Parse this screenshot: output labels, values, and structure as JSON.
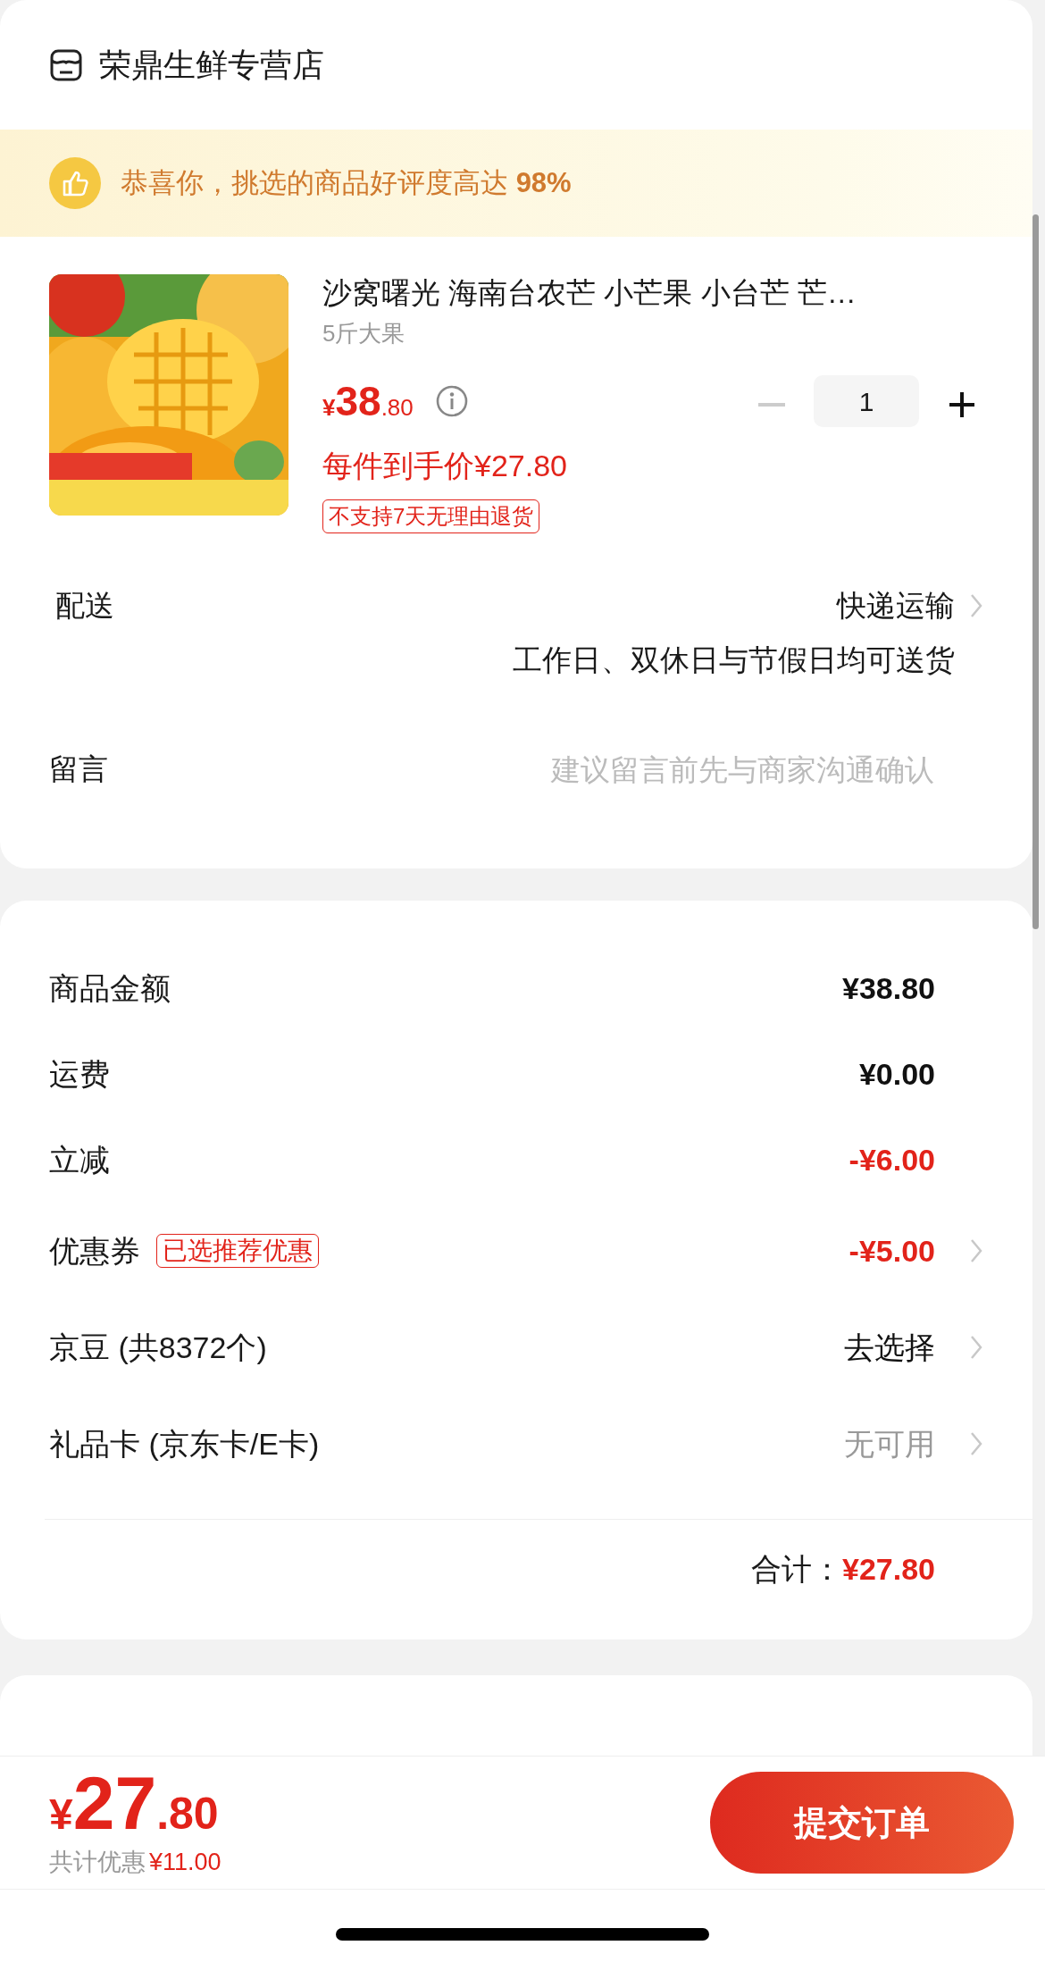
{
  "store": {
    "name": "荣鼎生鲜专营店"
  },
  "banner": {
    "text": "恭喜你，挑选的商品好评度高达 **98%**"
  },
  "product": {
    "title": "沙窝曙光 海南台农芒 小芒果 小台芒 芒…",
    "spec": "5斤大果",
    "price_symbol": "¥",
    "price_int": "38",
    "price_dec": ".80",
    "final_price": "每件到手价¥27.80",
    "quantity": "1",
    "decrement_disabled": true,
    "tag": "不支持7天无理由退货"
  },
  "delivery": {
    "label": "配送",
    "method": "快递运输",
    "note": "工作日、双休日与节假日均可送货"
  },
  "message": {
    "label": "留言",
    "placeholder": "建议留言前先与商家沟通确认"
  },
  "summary": {
    "rows": [
      {
        "label": "商品金额",
        "value": "¥38.80",
        "kind": "amount",
        "chevron": false
      },
      {
        "label": "运费",
        "value": "¥0.00",
        "kind": "amount",
        "chevron": false
      },
      {
        "label": "立减",
        "value": "-¥6.00",
        "kind": "discount",
        "chevron": false
      },
      {
        "label": "优惠券",
        "tag": "已选推荐优惠",
        "value": "-¥5.00",
        "kind": "discount",
        "chevron": true
      },
      {
        "label": "京豆 (共8372个)",
        "value": "去选择",
        "kind": "option",
        "chevron": true
      },
      {
        "label": "礼品卡 (京东卡/E卡)",
        "value": "无可用",
        "kind": "unavailable",
        "chevron": true
      }
    ],
    "total_label": "合计：",
    "total_value": "¥27.80"
  },
  "footer": {
    "currency": "¥",
    "price_int": "27",
    "price_dec": ".80",
    "saving_label": "共计优惠",
    "saving_value": "¥11.00",
    "submit": "提交订单"
  }
}
